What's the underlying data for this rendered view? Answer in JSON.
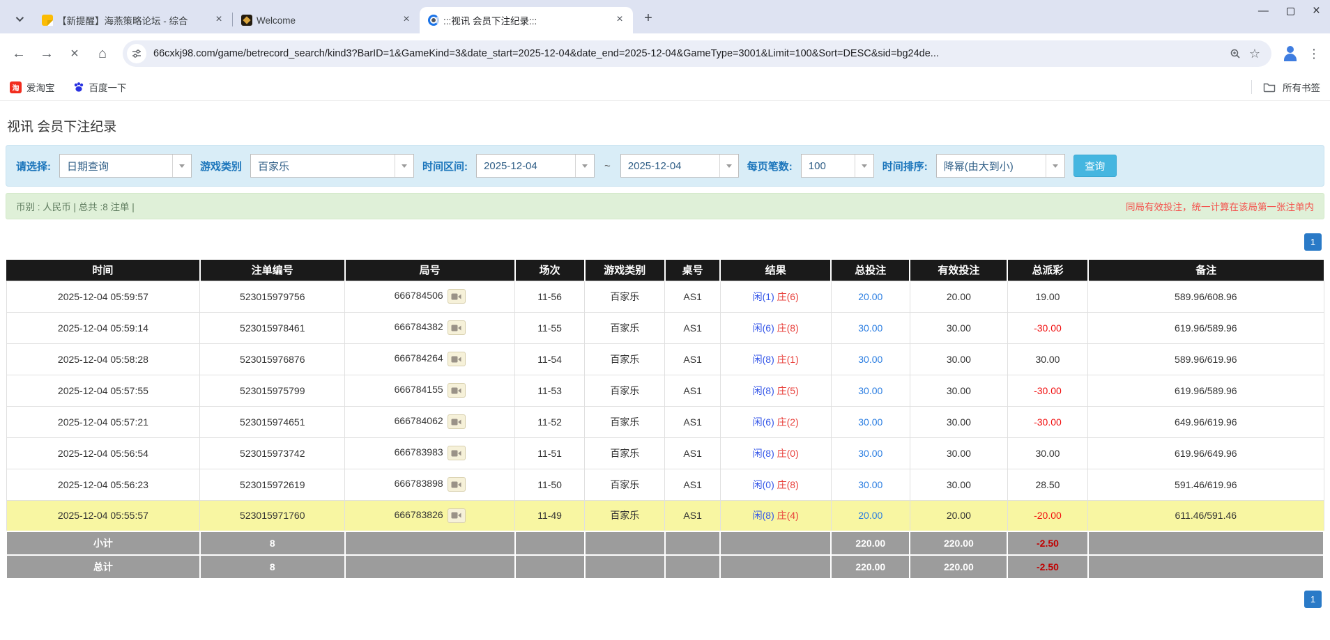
{
  "browser": {
    "tabs": [
      {
        "title": "【新提醒】海燕策略论坛 - 综合"
      },
      {
        "title": "Welcome"
      },
      {
        "title": ":::视讯 会员下注纪录:::"
      }
    ],
    "new_tab": "+",
    "url": "66cxkj98.com/game/betrecord_search/kind3?BarID=1&GameKind=3&date_start=2025-12-04&date_end=2025-12-04&GameType=3001&Limit=100&Sort=DESC&sid=bg24de...",
    "bookmarks": [
      {
        "label": "爱淘宝",
        "icon_text": "淘"
      },
      {
        "label": "百度一下"
      }
    ],
    "all_bookmarks": "所有书签"
  },
  "page": {
    "title": "视讯 会员下注纪录",
    "filters": {
      "select_label": "请选择:",
      "select_value": "日期查询",
      "game_category_label": "游戏类别",
      "game_category_value": "百家乐",
      "date_range_label": "时间区间:",
      "date_start": "2025-12-04",
      "tilde": "~",
      "date_end": "2025-12-04",
      "per_page_label": "每页笔数:",
      "per_page_value": "100",
      "sort_label": "时间排序:",
      "sort_value": "降幂(由大到小)",
      "search_button": "查询"
    },
    "info": {
      "left": "币别 : 人民币 | 总共 :8 注单 |",
      "right": "同局有效投注，统一计算在该局第一张注单内"
    },
    "pagination": "1",
    "table": {
      "headers": [
        "时间",
        "注单编号",
        "局号",
        "场次",
        "游戏类别",
        "桌号",
        "结果",
        "总投注",
        "有效投注",
        "总派彩",
        "备注"
      ],
      "rows": [
        {
          "time": "2025-12-04 05:59:57",
          "bet_id": "523015979756",
          "round": "666784506",
          "session": "11-56",
          "game": "百家乐",
          "table_no": "AS1",
          "player": "闲(1)",
          "banker": "庄(6)",
          "total_bet": "20.00",
          "valid_bet": "20.00",
          "payout": "19.00",
          "note": "589.96/608.96",
          "highlight": false
        },
        {
          "time": "2025-12-04 05:59:14",
          "bet_id": "523015978461",
          "round": "666784382",
          "session": "11-55",
          "game": "百家乐",
          "table_no": "AS1",
          "player": "闲(6)",
          "banker": "庄(8)",
          "total_bet": "30.00",
          "valid_bet": "30.00",
          "payout": "-30.00",
          "note": "619.96/589.96",
          "highlight": false
        },
        {
          "time": "2025-12-04 05:58:28",
          "bet_id": "523015976876",
          "round": "666784264",
          "session": "11-54",
          "game": "百家乐",
          "table_no": "AS1",
          "player": "闲(8)",
          "banker": "庄(1)",
          "total_bet": "30.00",
          "valid_bet": "30.00",
          "payout": "30.00",
          "note": "589.96/619.96",
          "highlight": false
        },
        {
          "time": "2025-12-04 05:57:55",
          "bet_id": "523015975799",
          "round": "666784155",
          "session": "11-53",
          "game": "百家乐",
          "table_no": "AS1",
          "player": "闲(8)",
          "banker": "庄(5)",
          "total_bet": "30.00",
          "valid_bet": "30.00",
          "payout": "-30.00",
          "note": "619.96/589.96",
          "highlight": false
        },
        {
          "time": "2025-12-04 05:57:21",
          "bet_id": "523015974651",
          "round": "666784062",
          "session": "11-52",
          "game": "百家乐",
          "table_no": "AS1",
          "player": "闲(6)",
          "banker": "庄(2)",
          "total_bet": "30.00",
          "valid_bet": "30.00",
          "payout": "-30.00",
          "note": "649.96/619.96",
          "highlight": false
        },
        {
          "time": "2025-12-04 05:56:54",
          "bet_id": "523015973742",
          "round": "666783983",
          "session": "11-51",
          "game": "百家乐",
          "table_no": "AS1",
          "player": "闲(8)",
          "banker": "庄(0)",
          "total_bet": "30.00",
          "valid_bet": "30.00",
          "payout": "30.00",
          "note": "619.96/649.96",
          "highlight": false
        },
        {
          "time": "2025-12-04 05:56:23",
          "bet_id": "523015972619",
          "round": "666783898",
          "session": "11-50",
          "game": "百家乐",
          "table_no": "AS1",
          "player": "闲(0)",
          "banker": "庄(8)",
          "total_bet": "30.00",
          "valid_bet": "30.00",
          "payout": "28.50",
          "note": "591.46/619.96",
          "highlight": false
        },
        {
          "time": "2025-12-04 05:55:57",
          "bet_id": "523015971760",
          "round": "666783826",
          "session": "11-49",
          "game": "百家乐",
          "table_no": "AS1",
          "player": "闲(8)",
          "banker": "庄(4)",
          "total_bet": "20.00",
          "valid_bet": "20.00",
          "payout": "-20.00",
          "note": "611.46/591.46",
          "highlight": true
        }
      ],
      "subtotal": {
        "label": "小计",
        "count": "8",
        "total_bet": "220.00",
        "valid_bet": "220.00",
        "payout": "-2.50"
      },
      "total": {
        "label": "总计",
        "count": "8",
        "total_bet": "220.00",
        "valid_bet": "220.00",
        "payout": "-2.50"
      }
    }
  },
  "colors": {
    "filter_label_blue": "#1b75bb",
    "search_button_cyan": "#45b6e0",
    "header_black": "#1a1a1a",
    "highlight_yellow": "#f8f6a2",
    "summary_gray": "#9c9c9c",
    "link_blue": "#2a7de1",
    "negative_red": "#f10e0e",
    "player_blue": "#3355e8",
    "banker_red": "#e8413c",
    "info_green_bg": "#dff0d8",
    "filter_bg": "#d9edf7",
    "pagination_blue": "#2a7ac7"
  }
}
